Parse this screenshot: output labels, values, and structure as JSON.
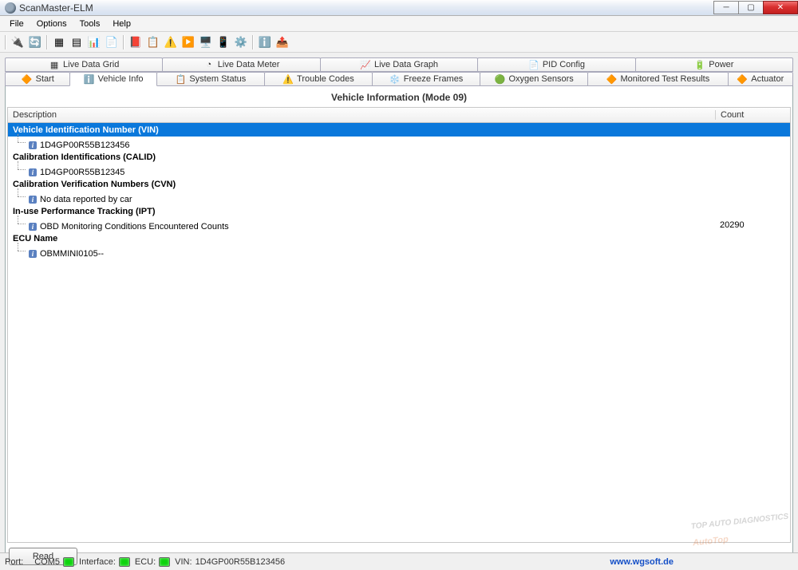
{
  "window": {
    "title": "ScanMaster-ELM"
  },
  "menu": {
    "file": "File",
    "options": "Options",
    "tools": "Tools",
    "help": "Help"
  },
  "tabs_upper": {
    "grid": "Live Data Grid",
    "meter": "Live Data Meter",
    "graph": "Live Data Graph",
    "pid": "PID Config",
    "power": "Power"
  },
  "tabs_lower": {
    "start": "Start",
    "vehicle": "Vehicle Info",
    "system": "System Status",
    "trouble": "Trouble Codes",
    "freeze": "Freeze Frames",
    "oxygen": "Oxygen Sensors",
    "monitored": "Monitored Test Results",
    "actuator": "Actuator"
  },
  "panel": {
    "title": "Vehicle Information (Mode 09)"
  },
  "columns": {
    "desc": "Description",
    "count": "Count"
  },
  "rows": [
    {
      "type": "group",
      "label": "Vehicle Identification Number (VIN)",
      "selected": true
    },
    {
      "type": "item",
      "label": "1D4GP00R55B123456"
    },
    {
      "type": "group",
      "label": "Calibration Identifications (CALID)"
    },
    {
      "type": "item",
      "label": "1D4GP00R55B12345"
    },
    {
      "type": "group",
      "label": "Calibration Verification Numbers (CVN)"
    },
    {
      "type": "item",
      "label": "No data reported by car"
    },
    {
      "type": "group",
      "label": "In-use Performance Tracking (IPT)"
    },
    {
      "type": "item",
      "label": "OBD Monitoring Conditions Encountered Counts",
      "count": "20290"
    },
    {
      "type": "group",
      "label": "ECU Name"
    },
    {
      "type": "item",
      "label": "OBMMINI0105--"
    }
  ],
  "buttons": {
    "read": "Read"
  },
  "status": {
    "port_label": "Port:",
    "port_value": "COM5",
    "interface_label": "Interface:",
    "ecu_label": "ECU:",
    "vin_label": "VIN:",
    "vin_value": "1D4GP00R55B123456",
    "url": "www.wgsoft.de"
  },
  "watermark": {
    "main": "AutoTop",
    "sub": "TOP AUTO DIAGNOSTICS"
  }
}
